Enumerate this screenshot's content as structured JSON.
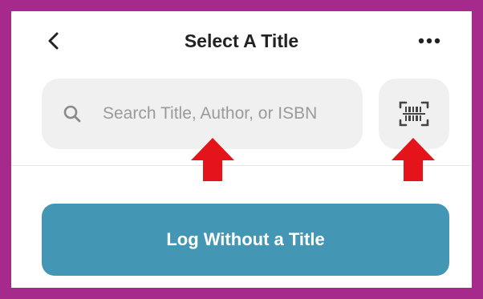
{
  "header": {
    "back_icon": "chevron-left-icon",
    "title": "Select A Title",
    "more_icon": "more-horizontal-icon"
  },
  "search": {
    "placeholder": "Search Title, Author, or ISBN",
    "value": "",
    "icon": "search-icon"
  },
  "scan": {
    "icon": "barcode-scan-icon"
  },
  "annotations": {
    "arrow_color": "#e5131a",
    "frame_color": "#a62a8c"
  },
  "actions": {
    "log_without_title_label": "Log Without a Title",
    "button_color": "#4497b4"
  }
}
